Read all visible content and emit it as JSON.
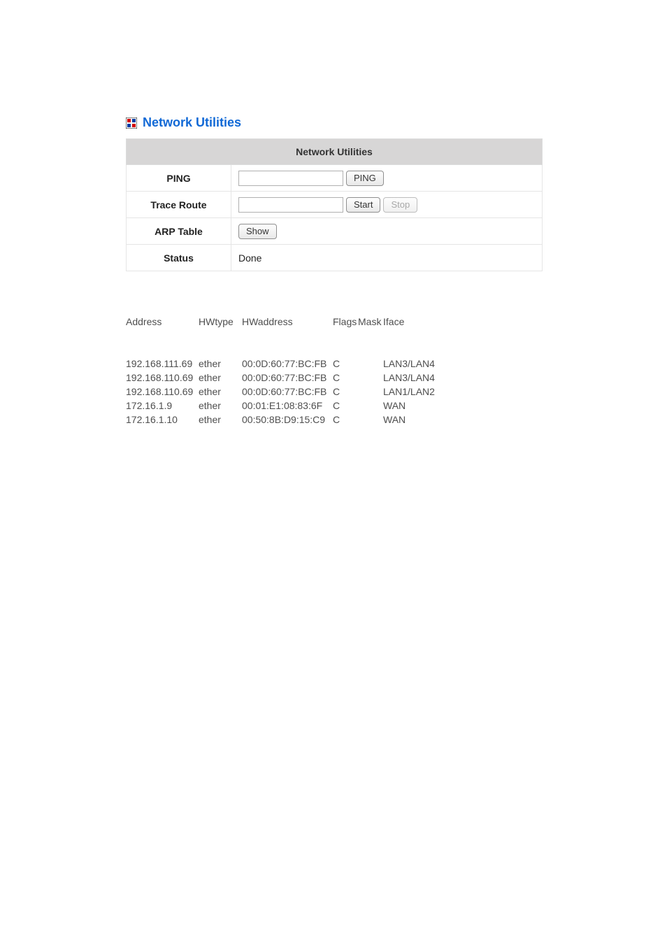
{
  "header": {
    "title": "Network Utilities"
  },
  "table": {
    "header": "Network Utilities",
    "rows": {
      "ping": {
        "label": "PING",
        "input_value": "",
        "button": "PING"
      },
      "trace": {
        "label": "Trace Route",
        "input_value": "",
        "start": "Start",
        "stop": "Stop"
      },
      "arp": {
        "label": "ARP Table",
        "show": "Show"
      },
      "status": {
        "label": "Status",
        "value": "Done"
      }
    }
  },
  "arp_output": {
    "headers": {
      "address": "Address",
      "hwtype": "HWtype",
      "hwaddress": "HWaddress",
      "flags": "Flags",
      "mask": "Mask",
      "iface": "Iface"
    },
    "rows": [
      {
        "address": "192.168.111.69",
        "hwtype": "ether",
        "hwaddress": "00:0D:60:77:BC:FB",
        "flags": "C",
        "mask": "",
        "iface": "LAN3/LAN4"
      },
      {
        "address": "192.168.110.69",
        "hwtype": "ether",
        "hwaddress": "00:0D:60:77:BC:FB",
        "flags": "C",
        "mask": "",
        "iface": "LAN3/LAN4"
      },
      {
        "address": "192.168.110.69",
        "hwtype": "ether",
        "hwaddress": "00:0D:60:77:BC:FB",
        "flags": "C",
        "mask": "",
        "iface": "LAN1/LAN2"
      },
      {
        "address": "172.16.1.9",
        "hwtype": "ether",
        "hwaddress": "00:01:E1:08:83:6F",
        "flags": "C",
        "mask": "",
        "iface": "WAN"
      },
      {
        "address": "172.16.1.10",
        "hwtype": "ether",
        "hwaddress": "00:50:8B:D9:15:C9",
        "flags": "C",
        "mask": "",
        "iface": "WAN"
      }
    ]
  }
}
